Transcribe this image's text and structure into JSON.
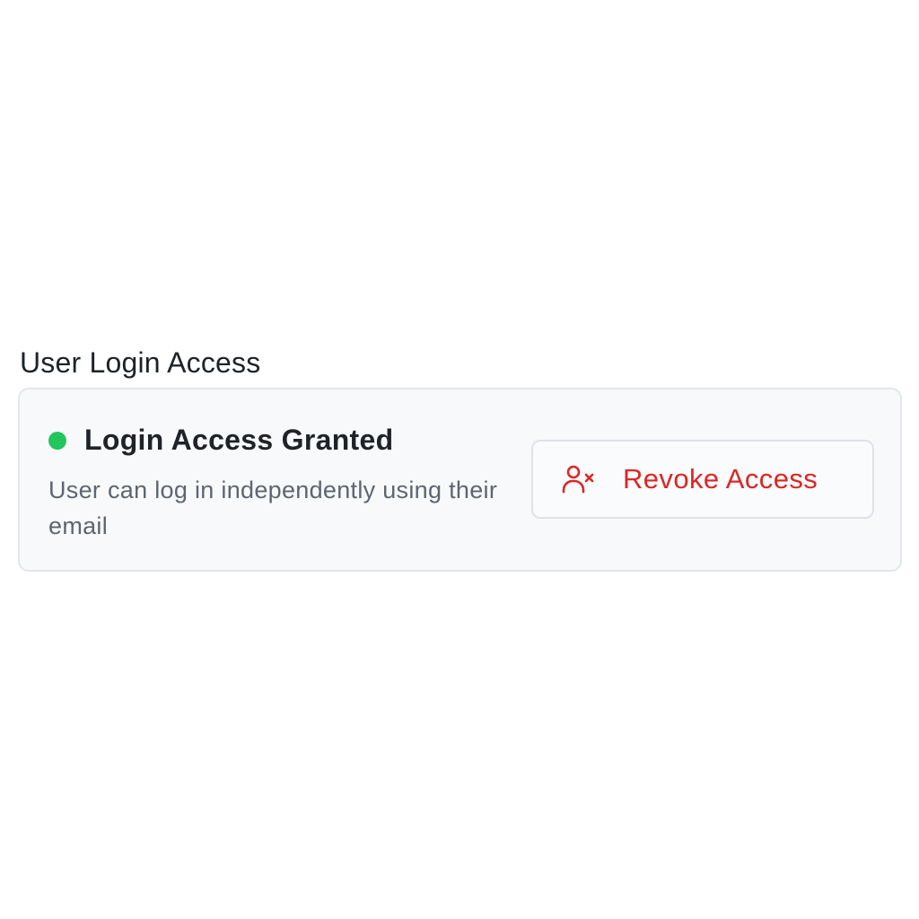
{
  "section": {
    "title": "User Login Access"
  },
  "status": {
    "label": "Login Access Granted",
    "indicator_color": "#22c55e",
    "description": "User can log in independently using their email"
  },
  "actions": {
    "revoke_label": "Revoke Access",
    "revoke_icon": "user-x-icon",
    "revoke_color": "#dc2626"
  }
}
